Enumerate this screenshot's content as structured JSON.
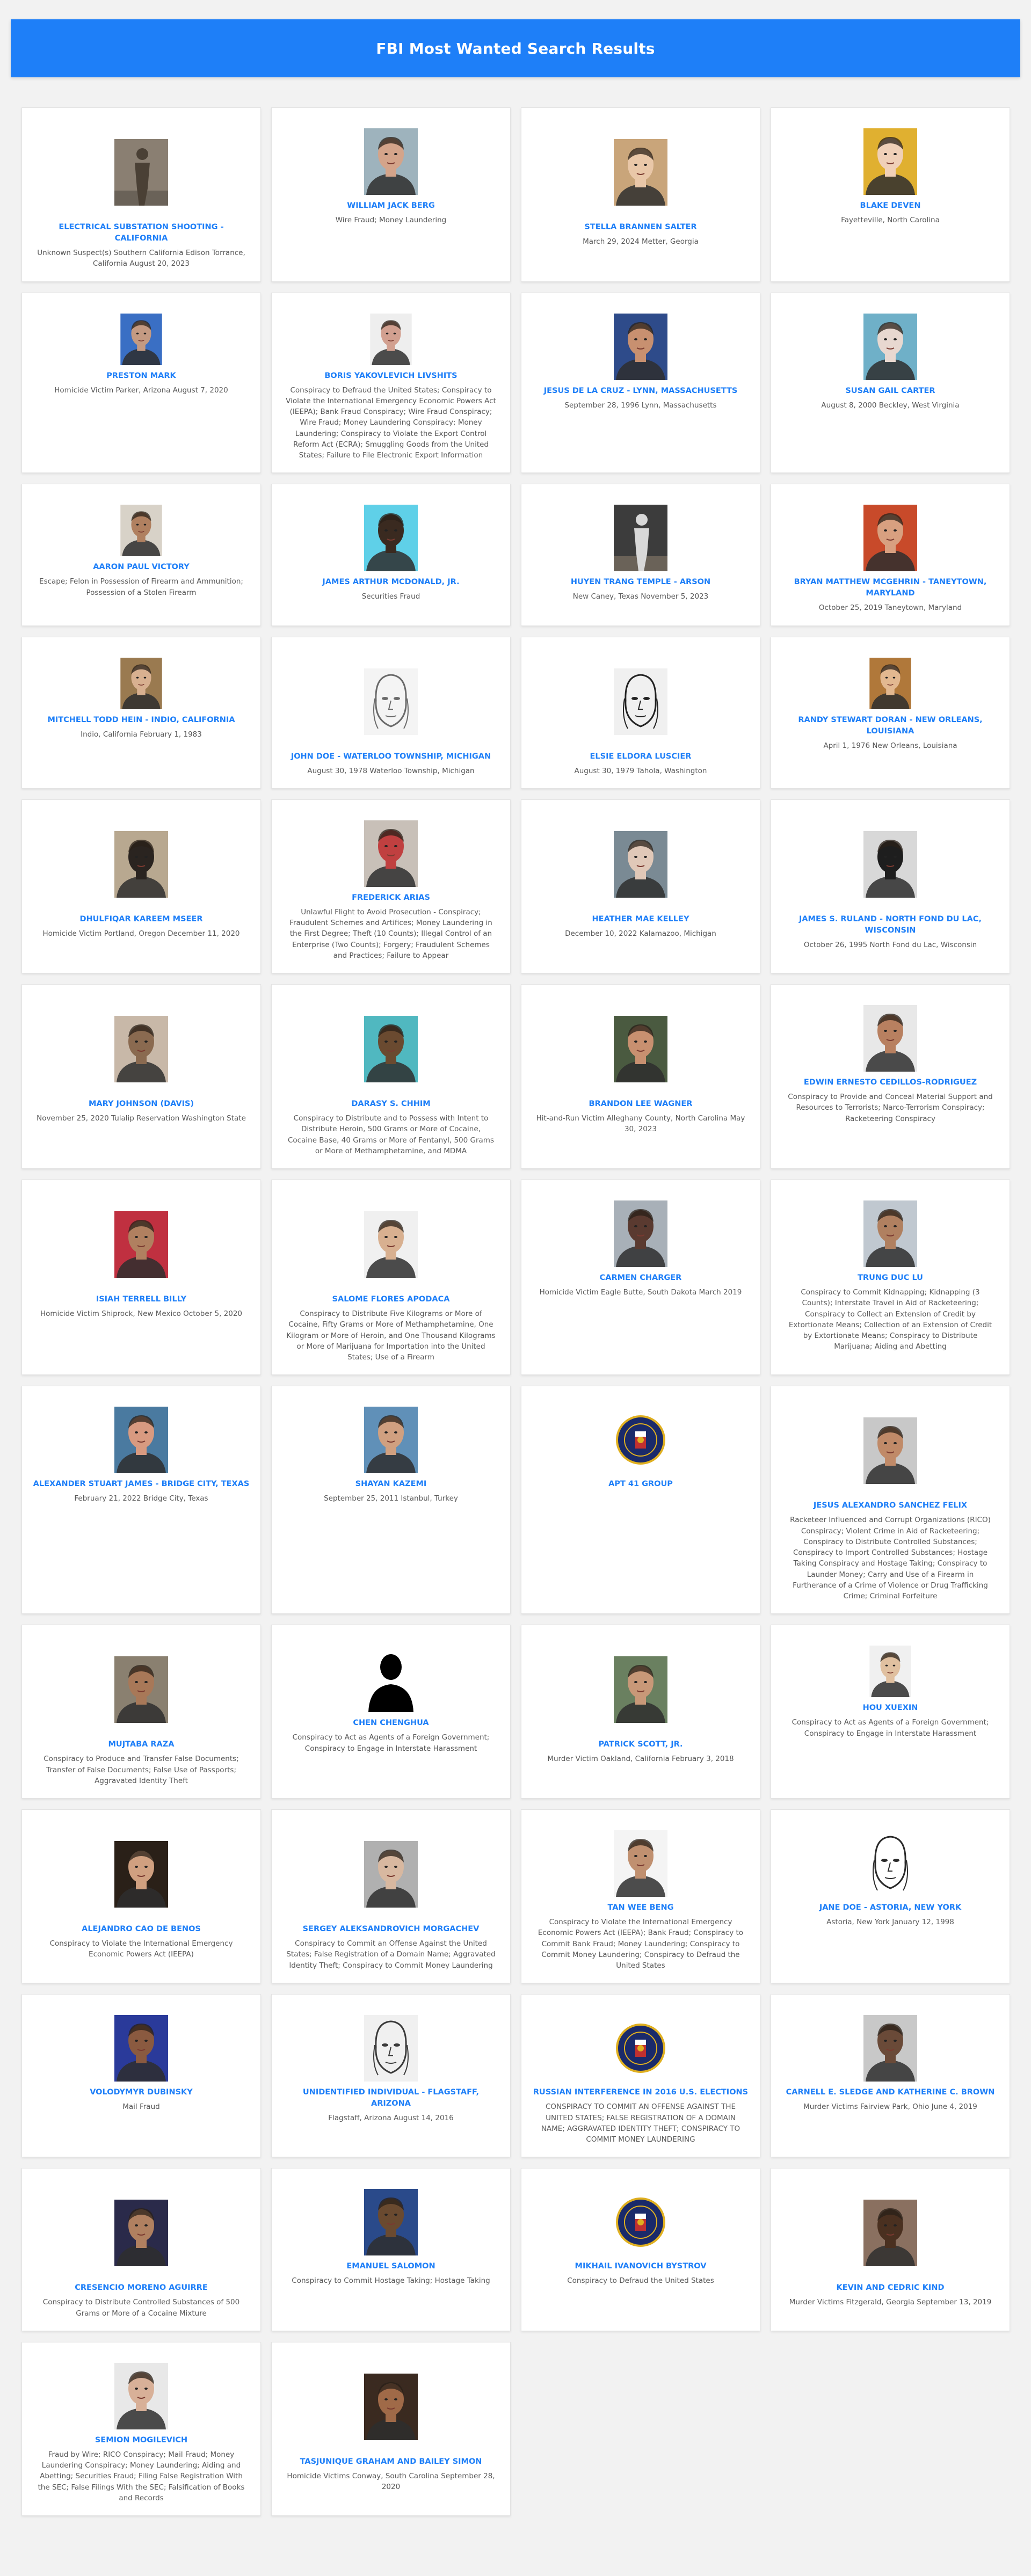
{
  "page": {
    "title": "FBI Most Wanted Search Results"
  },
  "colors": {
    "banner": "#1e7ff8",
    "name_link": "#1e7ff8",
    "background": "#f2f2f2"
  },
  "results": [
    {
      "name": "ELECTRICAL SUBSTATION SHOOTING - CALIFORNIA",
      "desc": "Unknown Suspect(s) Southern California Edison Torrance, California August 20, 2023",
      "icon": "surveillance-photo",
      "bg": "#8a7f72",
      "fg": "#4a4035",
      "size": "tall"
    },
    {
      "name": "WILLIAM JACK BERG",
      "desc": "Wire Fraud; Money Laundering",
      "icon": "person-photo",
      "bg": "#9eb3bd",
      "fg": "#d4a48a",
      "size": "normal"
    },
    {
      "name": "STELLA BRANNEN SALTER",
      "desc": "March 29, 2024 Metter, Georgia",
      "icon": "person-photo",
      "bg": "#c9a57a",
      "fg": "#e9c7a8",
      "size": "tall"
    },
    {
      "name": "BLAKE DEVEN",
      "desc": "Fayetteville, North Carolina",
      "icon": "person-photo",
      "bg": "#e0b030",
      "fg": "#f0d0b8",
      "size": "normal"
    },
    {
      "name": "PRESTON MARK",
      "desc": "Homicide Victim Parker, Arizona August 7, 2020",
      "icon": "person-photo",
      "bg": "#3a6fc4",
      "fg": "#c49a82",
      "size": "small"
    },
    {
      "name": "BORIS YAKOVLEVICH LIVSHITS",
      "desc": "Conspiracy to Defraud the United States; Conspiracy to Violate the International Emergency Economic Powers Act (IEEPA); Bank Fraud Conspiracy; Wire Fraud Conspiracy; Wire Fraud; Money Laundering Conspiracy; Money Laundering; Conspiracy to Violate the Export Control Reform Act (ECRA); Smuggling Goods from the United States; Failure to File Electronic Export Information",
      "icon": "person-photo",
      "bg": "#eeeeee",
      "fg": "#d2a090",
      "size": "small"
    },
    {
      "name": "JESUS DE LA CRUZ - LYNN, MASSACHUSETTS",
      "desc": "September 28, 1996 Lynn, Massachusetts",
      "icon": "person-photo",
      "bg": "#2e4b8a",
      "fg": "#c89070",
      "size": "normal"
    },
    {
      "name": "SUSAN GAIL CARTER",
      "desc": "August 8, 2000 Beckley, West Virginia",
      "icon": "person-photo",
      "bg": "#6fb0c8",
      "fg": "#e8d8d0",
      "size": "normal"
    },
    {
      "name": "AARON PAUL VICTORY",
      "desc": "Escape; Felon in Possession of Firearm and Ammunition; Possession of a Stolen Firearm",
      "icon": "person-photo",
      "bg": "#d8d2c8",
      "fg": "#b08060",
      "size": "small"
    },
    {
      "name": "JAMES ARTHUR MCDONALD, JR.",
      "desc": "Securities Fraud",
      "icon": "person-photo",
      "bg": "#5fd0e8",
      "fg": "#3a2a20",
      "size": "normal"
    },
    {
      "name": "HUYEN TRANG TEMPLE - ARSON",
      "desc": "New Caney, Texas November 5, 2023",
      "icon": "surveillance-photo",
      "bg": "#3c3c3c",
      "fg": "#d8d8d8",
      "size": "normal"
    },
    {
      "name": "BRYAN MATTHEW MCGEHRIN - TANEYTOWN, MARYLAND",
      "desc": "October 25, 2019 Taneytown, Maryland",
      "icon": "person-photo",
      "bg": "#c84a2a",
      "fg": "#d8a080",
      "size": "normal"
    },
    {
      "name": "MITCHELL TODD HEIN - INDIO, CALIFORNIA",
      "desc": "Indio, California February 1, 1983",
      "icon": "person-photo",
      "bg": "#9a7a50",
      "fg": "#d8b090",
      "size": "small"
    },
    {
      "name": "JOHN DOE - WATERLOO TOWNSHIP, MICHIGAN",
      "desc": "August 30, 1978 Waterloo Township, Michigan",
      "icon": "sketch-photo",
      "bg": "#f4f4f4",
      "fg": "#6a6a6a",
      "size": "tall"
    },
    {
      "name": "ELSIE ELDORA LUSCIER",
      "desc": "August 30, 1979 Tahola, Washington",
      "icon": "sketch-photo",
      "bg": "#f0f0f0",
      "fg": "#222222",
      "size": "tall"
    },
    {
      "name": "RANDY STEWART DORAN - NEW ORLEANS, LOUISIANA",
      "desc": "April 1, 1976 New Orleans, Louisiana",
      "icon": "person-photo",
      "bg": "#b0783a",
      "fg": "#e2b890",
      "size": "small"
    },
    {
      "name": "DHULFIQAR KAREEM MSEER",
      "desc": "Homicide Victim Portland, Oregon December 11, 2020",
      "icon": "person-photo",
      "bg": "#b8a890",
      "fg": "#2a2420",
      "size": "tall"
    },
    {
      "name": "FREDERICK ARIAS",
      "desc": "Unlawful Flight to Avoid Prosecution - Conspiracy; Fraudulent Schemes and Artifices; Money Laundering in the First Degree; Theft (10 Counts); Illegal Control of an Enterprise (Two Counts); Forgery; Fraudulent Schemes and Practices; Failure to Appear",
      "icon": "person-photo",
      "bg": "#c8c0b8",
      "fg": "#c04040",
      "size": "normal"
    },
    {
      "name": "HEATHER MAE KELLEY",
      "desc": "December 10, 2022 Kalamazoo, Michigan",
      "icon": "person-photo",
      "bg": "#7a8a94",
      "fg": "#e0c8b8",
      "size": "tall"
    },
    {
      "name": "JAMES S. RULAND - NORTH FOND du LAC, WISCONSIN",
      "desc": "October 26, 1995 North Fond du Lac, Wisconsin",
      "icon": "person-photo",
      "bg": "#d8d8d8",
      "fg": "#1e1e1e",
      "size": "tall"
    },
    {
      "name": "MARY JOHNSON (DAVIS)",
      "desc": "November 25, 2020 Tulalip Reservation Washington State",
      "icon": "person-photo",
      "bg": "#c8b8a8",
      "fg": "#8a6a50",
      "size": "tall"
    },
    {
      "name": "DARASY S. CHHIM",
      "desc": "Conspiracy to Distribute and to Possess with Intent to Distribute Heroin, 500 Grams or More of Cocaine, Cocaine Base, 40 Grams or More of Fentanyl, 500 Grams or More of Methamphetamine, and MDMA",
      "icon": "person-photo",
      "bg": "#50b8c0",
      "fg": "#6a4a30",
      "size": "tall"
    },
    {
      "name": "BRANDON LEE WAGNER",
      "desc": "Hit-and-Run Victim Alleghany County, North Carolina May 30, 2023",
      "icon": "person-photo",
      "bg": "#4a5a40",
      "fg": "#c89070",
      "size": "tall"
    },
    {
      "name": "EDWIN ERNESTO CEDILLOS-RODRIGUEZ",
      "desc": "Conspiracy to Provide and Conceal Material Support and Resources to Terrorists; Narco-Terrorism Conspiracy; Racketeering Conspiracy",
      "icon": "person-photo",
      "bg": "#e8e8e8",
      "fg": "#b88060",
      "size": "normal"
    },
    {
      "name": "ISIAH TERRELL BILLY",
      "desc": "Homicide Victim Shiprock, New Mexico October 5, 2020",
      "icon": "person-photo",
      "bg": "#c03040",
      "fg": "#b08060",
      "size": "tall"
    },
    {
      "name": "SALOME FLORES APODACA",
      "desc": "Conspiracy to Distribute Five Kilograms or More of Cocaine, Fifty Grams or More of Methamphetamine, One Kilogram or More of Heroin, and One Thousand Kilograms or More of Marijuana for Importation into the United States; Use of a Firearm",
      "icon": "person-photo",
      "bg": "#f0f0f0",
      "fg": "#d8b090",
      "size": "tall"
    },
    {
      "name": "CARMEN CHARGER",
      "desc": "Homicide Victim Eagle Butte, South Dakota March 2019",
      "icon": "person-photo",
      "bg": "#a8b0b8",
      "fg": "#5a3a30",
      "size": "normal"
    },
    {
      "name": "TRUNG DUC LU",
      "desc": "Conspiracy to Commit Kidnapping; Kidnapping (3 Counts); Interstate Travel in Aid of Racketeering; Conspiracy to Collect an Extension of Credit by Extortionate Means; Collection of an Extension of Credit by Extortionate Means; Conspiracy to Distribute Marijuana; Aiding and Abetting",
      "icon": "person-photo",
      "bg": "#c0c8d0",
      "fg": "#b08060",
      "size": "normal"
    },
    {
      "name": "ALEXANDER STUART JAMES - BRIDGE CITY, TEXAS",
      "desc": "February 21, 2022 Bridge City, Texas",
      "icon": "person-photo",
      "bg": "#4a7aa0",
      "fg": "#d89a80",
      "size": "normal"
    },
    {
      "name": "SHAYAN KAZEMI",
      "desc": "September 25, 2011 Istanbul, Turkey",
      "icon": "person-photo",
      "bg": "#6090b8",
      "fg": "#d0a080",
      "size": "normal"
    },
    {
      "name": "APT 41 GROUP",
      "desc": "",
      "icon": "fbi-seal",
      "bg": "#1a2a6a",
      "fg": "#e0b020",
      "size": "normal"
    },
    {
      "name": "JESUS ALEXANDRO SANCHEZ FELIX",
      "desc": "Racketeer Influenced and Corrupt Organizations (RICO) Conspiracy; Violent Crime in Aid of Racketeering; Conspiracy to Distribute Controlled Substances; Conspiracy to Import Controlled Substances; Hostage Taking Conspiracy and Hostage Taking; Conspiracy to Launder Money; Carry and Use of a Firearm in Furtherance of a Crime of Violence or Drug Trafficking Crime; Criminal Forfeiture",
      "icon": "person-photo",
      "bg": "#c8c8c8",
      "fg": "#c08a68",
      "size": "tall"
    },
    {
      "name": "MUJTABA RAZA",
      "desc": "Conspiracy to Produce and Transfer False Documents; Transfer of False Documents; False Use of Passports; Aggravated Identity Theft",
      "icon": "person-photo",
      "bg": "#8a8070",
      "fg": "#a87858",
      "size": "tall"
    },
    {
      "name": "CHEN CHENGHUA",
      "desc": "Conspiracy to Act as Agents of a Foreign Government; Conspiracy to Engage in Interstate Harassment",
      "icon": "silhouette",
      "bg": "#ffffff",
      "fg": "#000000",
      "size": "normal"
    },
    {
      "name": "PATRICK SCOTT, JR.",
      "desc": "Murder Victim Oakland, California February 3, 2018",
      "icon": "person-photo",
      "bg": "#6a8060",
      "fg": "#c89878",
      "size": "tall"
    },
    {
      "name": "HOU XUEXIN",
      "desc": "Conspiracy to Act as Agents of a Foreign Government; Conspiracy to Engage in Interstate Harassment",
      "icon": "person-photo",
      "bg": "#f0f0f0",
      "fg": "#e0c0a0",
      "size": "small"
    },
    {
      "name": "ALEJANDRO CAO DE BENOS",
      "desc": "Conspiracy to Violate the International Emergency Economic Powers Act (IEEPA)",
      "icon": "person-photo",
      "bg": "#2a2018",
      "fg": "#d0a080",
      "size": "tall"
    },
    {
      "name": "SERGEY ALEKSANDROVICH MORGACHEV",
      "desc": "Conspiracy to Commit an Offense Against the United States; False Registration of a Domain Name; Aggravated Identity Theft; Conspiracy to Commit Money Laundering",
      "icon": "person-photo",
      "bg": "#b0b0b0",
      "fg": "#d8b8a0",
      "size": "tall"
    },
    {
      "name": "TAN WEE BENG",
      "desc": "Conspiracy to Violate the International Emergency Economic Powers Act (IEEPA); Bank Fraud; Conspiracy to Commit Bank Fraud; Money Laundering; Conspiracy to Commit Money Laundering; Conspiracy to Defraud the United States",
      "icon": "person-photo",
      "bg": "#f4f4f4",
      "fg": "#c09070",
      "size": "normal"
    },
    {
      "name": "JANE DOE - ASTORIA, NEW YORK",
      "desc": "Astoria, New York January 12, 1998",
      "icon": "sketch-photo",
      "bg": "#ffffff",
      "fg": "#2a2a2a",
      "size": "normal"
    },
    {
      "name": "VOLODYMYR DUBINSKY",
      "desc": "Mail Fraud",
      "icon": "person-photo",
      "bg": "#2a3a9a",
      "fg": "#8a5a40",
      "size": "normal"
    },
    {
      "name": "UNIDENTIFIED INDIVIDUAL - FLAGSTAFF, ARIZONA",
      "desc": "Flagstaff, Arizona August 14, 2016",
      "icon": "sketch-photo",
      "bg": "#f0f0f0",
      "fg": "#3a3a3a",
      "size": "normal"
    },
    {
      "name": "RUSSIAN INTERFERENCE IN 2016 U.S. ELECTIONS",
      "desc": "CONSPIRACY TO COMMIT AN OFFENSE AGAINST THE UNITED STATES; FALSE REGISTRATION OF A DOMAIN NAME; AGGRAVATED IDENTITY THEFT; CONSPIRACY TO COMMIT MONEY LAUNDERING",
      "icon": "fbi-seal",
      "bg": "#1a2a6a",
      "fg": "#e0b020",
      "size": "normal"
    },
    {
      "name": "CARNELL E. SLEDGE AND KATHERINE C. BROWN",
      "desc": "Murder Victims Fairview Park, Ohio June 4, 2019",
      "icon": "person-photo",
      "bg": "#c8c8c8",
      "fg": "#6a4a38",
      "size": "normal"
    },
    {
      "name": "CRESENCIO MORENO AGUIRRE",
      "desc": "Conspiracy to Distribute Controlled Substances of 500 Grams or More of a Cocaine Mixture",
      "icon": "person-photo",
      "bg": "#2a2a4a",
      "fg": "#b08060",
      "size": "tall"
    },
    {
      "name": "EMANUEL SALOMON",
      "desc": "Conspiracy to Commit Hostage Taking; Hostage Taking",
      "icon": "person-photo",
      "bg": "#2a4a8a",
      "fg": "#6a4a30",
      "size": "normal"
    },
    {
      "name": "MIKHAIL IVANOVICH BYSTROV",
      "desc": "Conspiracy to Defraud the United States",
      "icon": "fbi-seal",
      "bg": "#1a2a6a",
      "fg": "#e0b020",
      "size": "normal"
    },
    {
      "name": "KEVIN AND CEDRIC KIND",
      "desc": "Murder Victims Fitzgerald, Georgia September 13, 2019",
      "icon": "person-photo",
      "bg": "#8a7060",
      "fg": "#4a3020",
      "size": "tall"
    },
    {
      "name": "SEMION MOGILEVICH",
      "desc": "Fraud by Wire; RICO Conspiracy; Mail Fraud; Money Laundering Conspiracy; Money Laundering; Aiding and Abetting; Securities Fraud; Filing False Registration With the SEC; False Filings With the SEC; Falsification of Books and Records",
      "icon": "person-photo",
      "bg": "#e8e8e8",
      "fg": "#d8b098",
      "size": "normal"
    },
    {
      "name": "TASJUNIQUE GRAHAM AND BAILEY SIMON",
      "desc": "Homicide Victims Conway, South Carolina September 28, 2020",
      "icon": "person-photo",
      "bg": "#3a2a20",
      "fg": "#a06a48",
      "size": "tall"
    }
  ]
}
